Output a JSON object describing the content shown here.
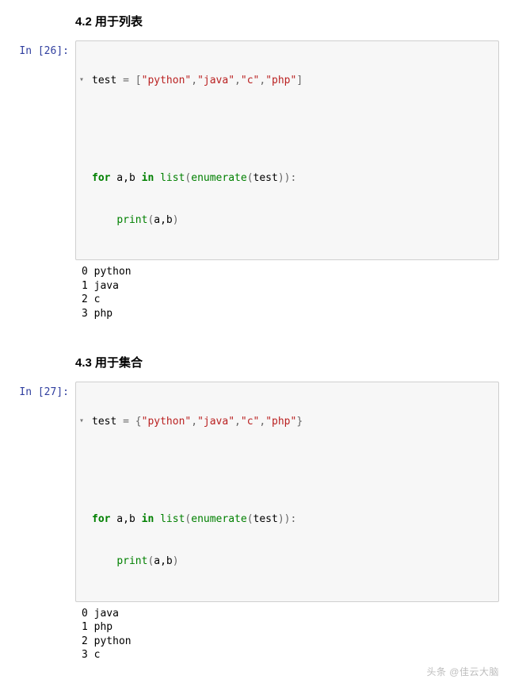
{
  "sections": [
    {
      "heading": "4.2 用于列表",
      "prompt": "In [26]:",
      "code": {
        "line1": {
          "var": "test",
          "eq": " = ",
          "br_open": "[",
          "items": [
            "\"python\"",
            "\"java\"",
            "\"c\"",
            "\"php\""
          ],
          "comma": ",",
          "br_close": "]"
        },
        "line2": {
          "for_kw": "for",
          "vars": " a,b ",
          "in_kw": "in",
          "sp": " ",
          "list_fn": "list",
          "paren_open": "(",
          "enum_fn": "enumerate",
          "inner_open": "(",
          "arg": "test",
          "inner_close": ")",
          "paren_close": ")",
          "colon": ":"
        },
        "line3": {
          "indent": "    ",
          "print_fn": "print",
          "paren_open": "(",
          "args": "a,b",
          "paren_close": ")"
        }
      },
      "output": "0 python\n1 java\n2 c\n3 php"
    },
    {
      "heading": "4.3 用于集合",
      "prompt": "In [27]:",
      "code": {
        "line1": {
          "var": "test",
          "eq": " = ",
          "br_open": "{",
          "items": [
            "\"python\"",
            "\"java\"",
            "\"c\"",
            "\"php\""
          ],
          "comma": ",",
          "br_close": "}"
        },
        "line2": {
          "for_kw": "for",
          "vars": " a,b ",
          "in_kw": "in",
          "sp": " ",
          "list_fn": "list",
          "paren_open": "(",
          "enum_fn": "enumerate",
          "inner_open": "(",
          "arg": "test",
          "inner_close": ")",
          "paren_close": ")",
          "colon": ":"
        },
        "line3": {
          "indent": "    ",
          "print_fn": "print",
          "paren_open": "(",
          "args": "a,b",
          "paren_close": ")"
        }
      },
      "output": "0 java\n1 php\n2 python\n3 c"
    }
  ],
  "watermark": "头条 @佳云大脑"
}
